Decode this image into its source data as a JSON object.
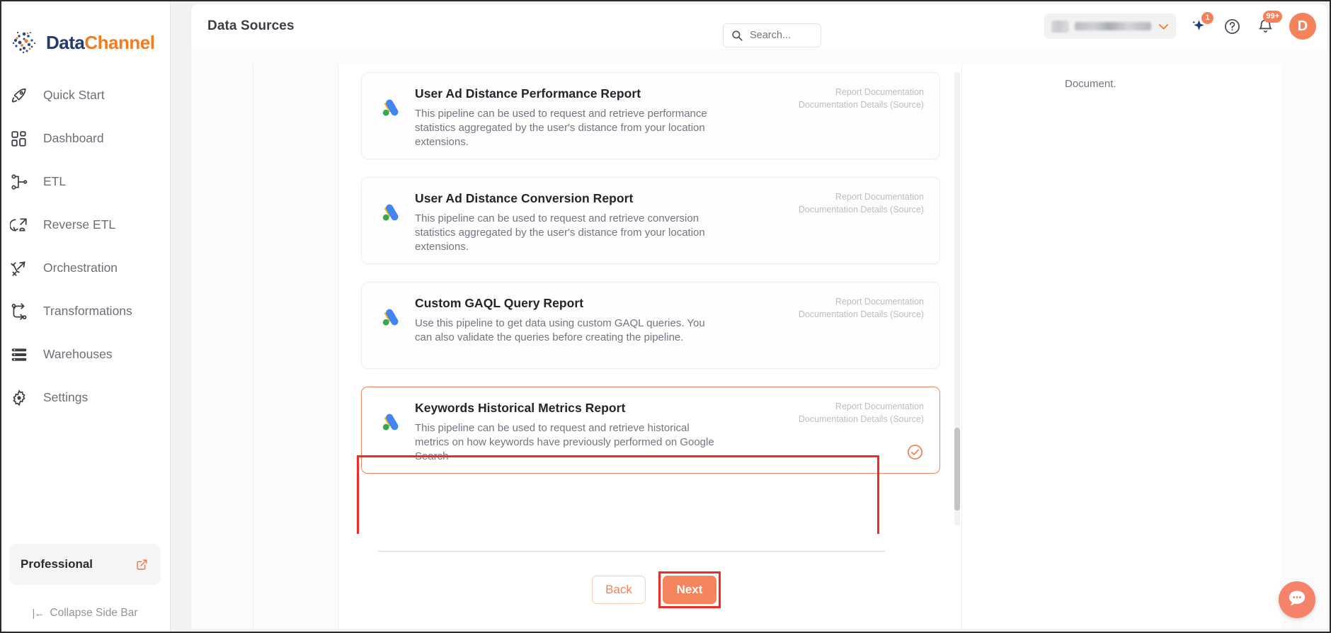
{
  "brand": {
    "name_part1": "Data",
    "name_part2": "Channel",
    "colors": {
      "navy": "#253b6e",
      "orange": "#f47b20",
      "accent": "#f4845b",
      "annotation": "#ef2b25"
    }
  },
  "sidebar": {
    "items": [
      {
        "label": "Quick Start",
        "icon": "rocket-icon"
      },
      {
        "label": "Dashboard",
        "icon": "grid-icon"
      },
      {
        "label": "ETL",
        "icon": "etl-flow-icon"
      },
      {
        "label": "Reverse ETL",
        "icon": "reverse-etl-icon"
      },
      {
        "label": "Orchestration",
        "icon": "orchestration-icon"
      },
      {
        "label": "Transformations",
        "icon": "transformations-icon"
      },
      {
        "label": "Warehouses",
        "icon": "warehouse-stack-icon"
      },
      {
        "label": "Settings",
        "icon": "gear-icon"
      }
    ],
    "plan": {
      "label": "Professional",
      "icon": "external-link-icon"
    },
    "collapse": {
      "prefix": "|←",
      "label": "Collapse Side Bar"
    }
  },
  "header": {
    "title": "Data Sources",
    "search": {
      "placeholder": "Search...",
      "value": "",
      "icon": "search-icon"
    },
    "workspace": {
      "value": "",
      "icon": "chevron-down-icon"
    },
    "ai_badge": "1",
    "notification_badge": "99+",
    "help_icon": "question-circle-icon",
    "bell_icon": "bell-icon",
    "spark_icon": "sparkle-icon",
    "avatar_initial": "D"
  },
  "main": {
    "right_panel_text": "Document.",
    "doc_links": {
      "line1": "Report Documentation",
      "line2": "Documentation Details (Source)"
    },
    "cards": [
      {
        "title": "User Ad Distance Performance Report",
        "description": "This pipeline can be used to request and retrieve performance statistics aggregated by the user's distance from your location extensions.",
        "icon": "google-ads-icon",
        "selected": false
      },
      {
        "title": "User Ad Distance Conversion Report",
        "description": "This pipeline can be used to request and retrieve conversion statistics aggregated by the user's distance from your location extensions.",
        "icon": "google-ads-icon",
        "selected": false
      },
      {
        "title": "Custom GAQL Query Report",
        "description": "Use this pipeline to get data using custom GAQL queries. You can also validate the queries before creating the pipeline.",
        "icon": "google-ads-icon",
        "selected": false
      },
      {
        "title": "Keywords Historical Metrics Report",
        "description": "This pipeline can be used to request and retrieve historical metrics on how keywords have previously performed on Google Search",
        "icon": "google-ads-icon",
        "selected": true,
        "check_icon": "check-circle-icon"
      }
    ],
    "buttons": {
      "back": "Back",
      "next": "Next"
    }
  },
  "support": {
    "icon": "chat-bubble-icon"
  }
}
